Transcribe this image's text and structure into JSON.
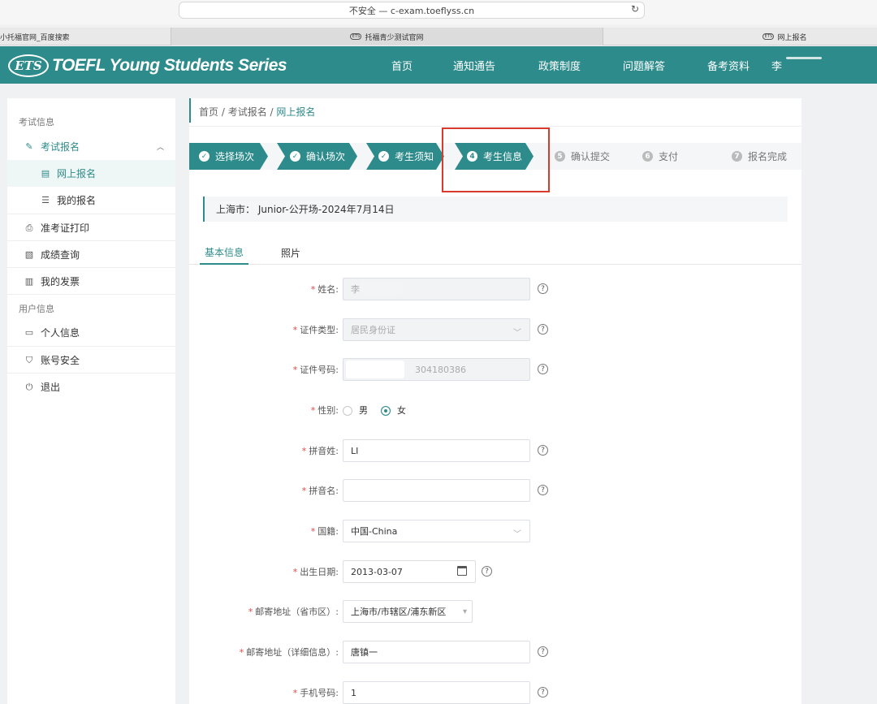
{
  "browser": {
    "address": "不安全 — c-exam.toeflyss.cn",
    "tabs": [
      "小托福官网_百度搜索",
      "托福青少测试官网",
      "网上报名"
    ]
  },
  "header": {
    "logo_mark": "ETS",
    "logo_text": "TOEFL Young Students Series",
    "nav": [
      "首页",
      "通知通告",
      "政策制度",
      "问题解答",
      "备考资料"
    ],
    "user": "李"
  },
  "sidebar": {
    "group1": "考试信息",
    "exam_reg": "考试报名",
    "online_reg": "网上报名",
    "my_reg": "我的报名",
    "admit_print": "准考证打印",
    "score_query": "成绩查询",
    "my_invoice": "我的发票",
    "group2": "用户信息",
    "personal_info": "个人信息",
    "account_security": "账号安全",
    "logout": "退出"
  },
  "breadcrumb": [
    "首页",
    "考试报名",
    "网上报名"
  ],
  "steps": [
    {
      "label": "选择场次",
      "status": "done"
    },
    {
      "label": "确认场次",
      "status": "done"
    },
    {
      "label": "考生须知",
      "status": "done"
    },
    {
      "num": "4",
      "label": "考生信息",
      "status": "current"
    },
    {
      "num": "5",
      "label": "确认提交",
      "status": "todo"
    },
    {
      "num": "6",
      "label": "支付",
      "status": "todo"
    },
    {
      "num": "7",
      "label": "报名完成",
      "status": "todo"
    }
  ],
  "session": "上海市： Junior-公开场-2024年7月14日",
  "form_tabs": [
    "基本信息",
    "照片"
  ],
  "form": {
    "name_label": "姓名:",
    "name_value": "李",
    "id_type_label": "证件类型:",
    "id_type_value": "居民身份证",
    "id_no_label": "证件号码:",
    "id_no_value": "304180386",
    "gender_label": "性别:",
    "gender_male": "男",
    "gender_female": "女",
    "gender_selected": "女",
    "pinyin_last_label": "拼音姓:",
    "pinyin_last_value": "LI",
    "pinyin_first_label": "拼音名:",
    "pinyin_first_value": "",
    "nationality_label": "国籍:",
    "nationality_value": "中国-China",
    "birth_label": "出生日期:",
    "birth_value": "2013-03-07",
    "mail_region_label": "邮寄地址（省市区）:",
    "mail_region_value": "上海市/市辖区/浦东新区",
    "mail_detail_label": "邮寄地址（详细信息）:",
    "mail_detail_value": "唐镇一",
    "phone_label": "手机号码:",
    "phone_value": "1"
  },
  "colors": {
    "primary": "#2e8b8b",
    "highlight": "#d83a2e"
  }
}
